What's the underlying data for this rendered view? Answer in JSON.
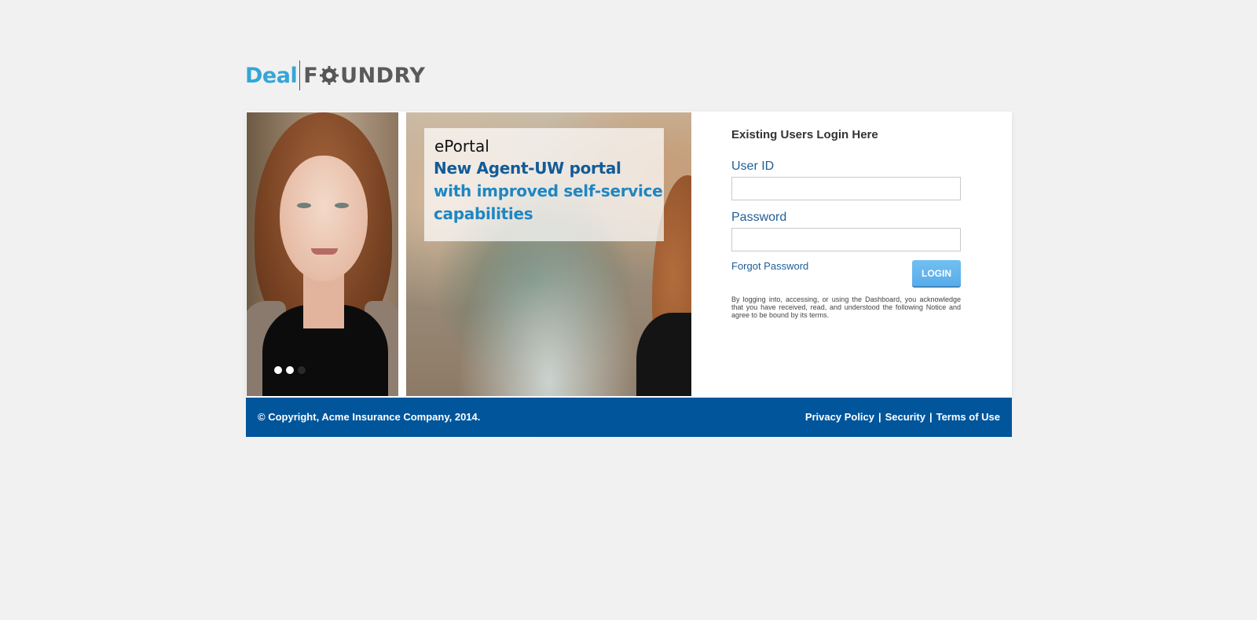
{
  "logo": {
    "deal": "Deal",
    "foundry_prefix": "F",
    "foundry_suffix": "UNDRY",
    "colors": {
      "deal": "#35a6d8",
      "foundry": "#5a5a5a"
    }
  },
  "promo": {
    "title": "ePortal",
    "line1": "New Agent-UW portal",
    "line2": "with improved self-service",
    "line3": "capabilities"
  },
  "carousel": {
    "dots": 3,
    "active_dot": 3
  },
  "login": {
    "heading": "Existing Users Login Here",
    "user_id_label": "User ID",
    "user_id_value": "",
    "password_label": "Password",
    "password_value": "",
    "forgot_password": "Forgot Password",
    "login_button": "LOGIN",
    "notice": "By logging into, accessing, or using the Dashboard, you acknowledge that you have received, read, and understood the following Notice and agree to be bound by its terms."
  },
  "footer": {
    "copyright": "© Copyright, Acme Insurance Company, 2014.",
    "links": [
      "Privacy Policy",
      "Security",
      "Terms of Use"
    ],
    "separator": "|",
    "background": "#00559b"
  }
}
